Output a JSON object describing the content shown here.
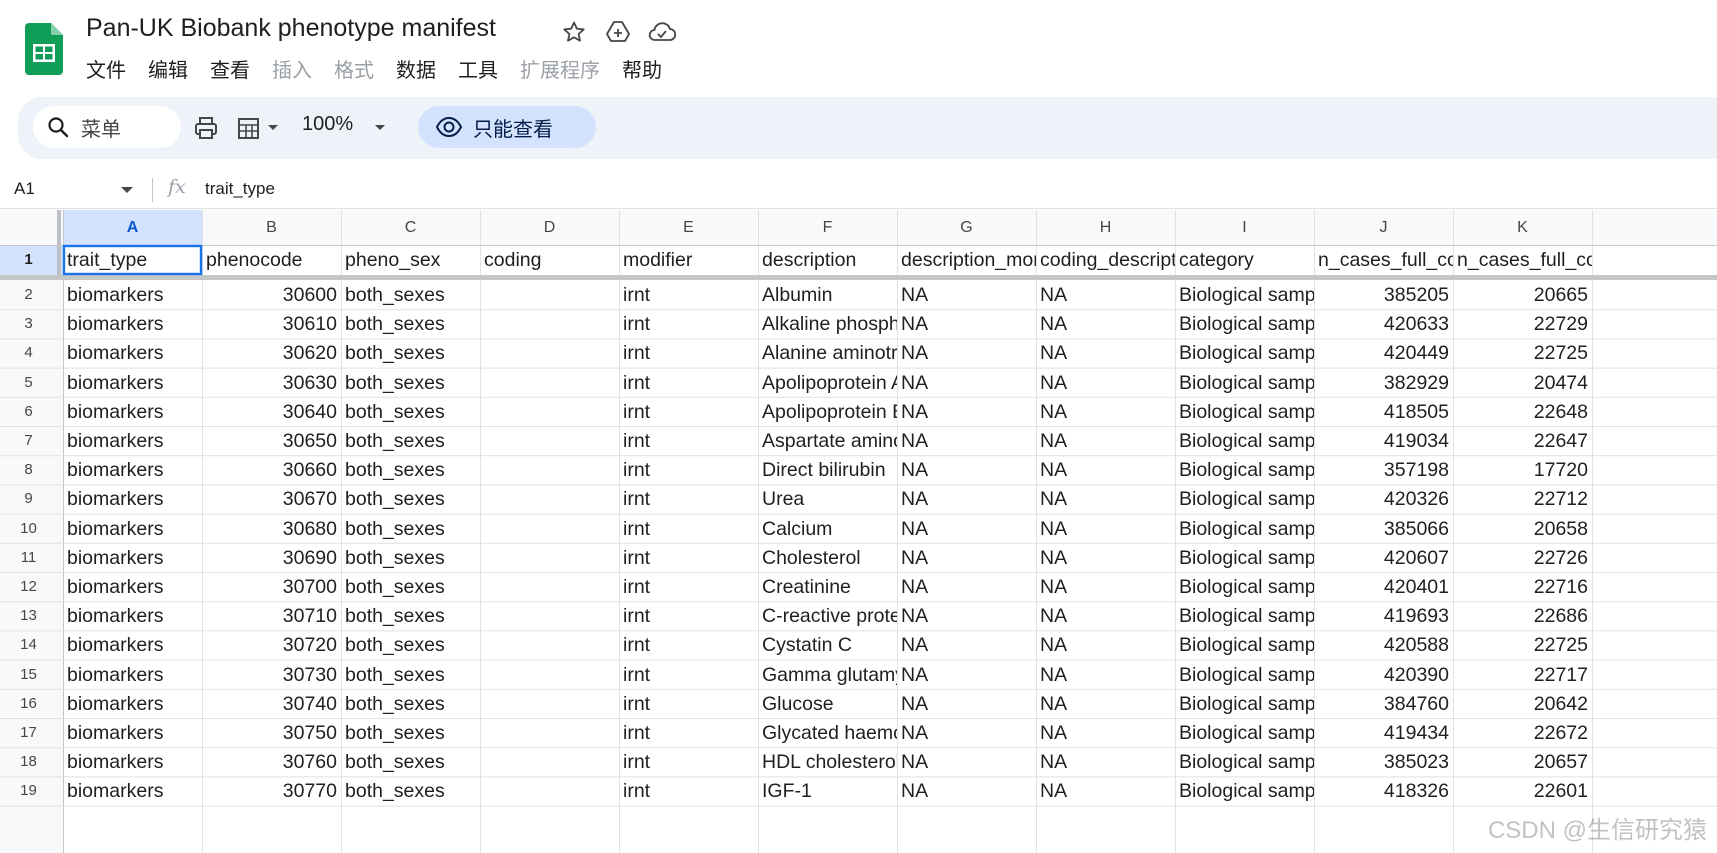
{
  "app": {
    "title": "Pan-UK Biobank phenotype manifest",
    "brand_color": "#0f9d58"
  },
  "title_icons": [
    "star-icon",
    "move-to-drive-icon",
    "cloud-status-icon"
  ],
  "menu": [
    {
      "label": "文件",
      "enabled": true
    },
    {
      "label": "编辑",
      "enabled": true
    },
    {
      "label": "查看",
      "enabled": true
    },
    {
      "label": "插入",
      "enabled": false
    },
    {
      "label": "格式",
      "enabled": false
    },
    {
      "label": "数据",
      "enabled": true
    },
    {
      "label": "工具",
      "enabled": true
    },
    {
      "label": "扩展程序",
      "enabled": false
    },
    {
      "label": "帮助",
      "enabled": true
    }
  ],
  "toolbar": {
    "search_label": "菜单",
    "zoom": "100%",
    "view_only_label": "只能查看"
  },
  "formula_bar": {
    "cell_ref": "A1",
    "fx": "fx",
    "content": "trait_type"
  },
  "sheet": {
    "columns": [
      "A",
      "B",
      "C",
      "D",
      "E",
      "F",
      "G",
      "H",
      "I",
      "J",
      "K"
    ],
    "active_column": "A",
    "header_row": [
      "trait_type",
      "phenocode",
      "pheno_sex",
      "coding",
      "modifier",
      "description",
      "description_more",
      "coding_description",
      "category",
      "n_cases_full_cohort_both_sexes",
      "n_cases_full_cohort_females"
    ],
    "rows": [
      {
        "n": "2",
        "cells": [
          "biomarkers",
          "30600",
          "both_sexes",
          "",
          "irnt",
          "Albumin",
          "NA",
          "NA",
          "Biological samples",
          "385205",
          "20665"
        ]
      },
      {
        "n": "3",
        "cells": [
          "biomarkers",
          "30610",
          "both_sexes",
          "",
          "irnt",
          "Alkaline phosphatase",
          "NA",
          "NA",
          "Biological samples",
          "420633",
          "22729"
        ]
      },
      {
        "n": "4",
        "cells": [
          "biomarkers",
          "30620",
          "both_sexes",
          "",
          "irnt",
          "Alanine aminotransferase",
          "NA",
          "NA",
          "Biological samples",
          "420449",
          "22725"
        ]
      },
      {
        "n": "5",
        "cells": [
          "biomarkers",
          "30630",
          "both_sexes",
          "",
          "irnt",
          "Apolipoprotein A",
          "NA",
          "NA",
          "Biological samples",
          "382929",
          "20474"
        ]
      },
      {
        "n": "6",
        "cells": [
          "biomarkers",
          "30640",
          "both_sexes",
          "",
          "irnt",
          "Apolipoprotein B",
          "NA",
          "NA",
          "Biological samples",
          "418505",
          "22648"
        ]
      },
      {
        "n": "7",
        "cells": [
          "biomarkers",
          "30650",
          "both_sexes",
          "",
          "irnt",
          "Aspartate aminotransferase",
          "NA",
          "NA",
          "Biological samples",
          "419034",
          "22647"
        ]
      },
      {
        "n": "8",
        "cells": [
          "biomarkers",
          "30660",
          "both_sexes",
          "",
          "irnt",
          "Direct bilirubin",
          "NA",
          "NA",
          "Biological samples",
          "357198",
          "17720"
        ]
      },
      {
        "n": "9",
        "cells": [
          "biomarkers",
          "30670",
          "both_sexes",
          "",
          "irnt",
          "Urea",
          "NA",
          "NA",
          "Biological samples",
          "420326",
          "22712"
        ]
      },
      {
        "n": "10",
        "cells": [
          "biomarkers",
          "30680",
          "both_sexes",
          "",
          "irnt",
          "Calcium",
          "NA",
          "NA",
          "Biological samples",
          "385066",
          "20658"
        ]
      },
      {
        "n": "11",
        "cells": [
          "biomarkers",
          "30690",
          "both_sexes",
          "",
          "irnt",
          "Cholesterol",
          "NA",
          "NA",
          "Biological samples",
          "420607",
          "22726"
        ]
      },
      {
        "n": "12",
        "cells": [
          "biomarkers",
          "30700",
          "both_sexes",
          "",
          "irnt",
          "Creatinine",
          "NA",
          "NA",
          "Biological samples",
          "420401",
          "22716"
        ]
      },
      {
        "n": "13",
        "cells": [
          "biomarkers",
          "30710",
          "both_sexes",
          "",
          "irnt",
          "C-reactive protein",
          "NA",
          "NA",
          "Biological samples",
          "419693",
          "22686"
        ]
      },
      {
        "n": "14",
        "cells": [
          "biomarkers",
          "30720",
          "both_sexes",
          "",
          "irnt",
          "Cystatin C",
          "NA",
          "NA",
          "Biological samples",
          "420588",
          "22725"
        ]
      },
      {
        "n": "15",
        "cells": [
          "biomarkers",
          "30730",
          "both_sexes",
          "",
          "irnt",
          "Gamma glutamyltransferase",
          "NA",
          "NA",
          "Biological samples",
          "420390",
          "22717"
        ]
      },
      {
        "n": "16",
        "cells": [
          "biomarkers",
          "30740",
          "both_sexes",
          "",
          "irnt",
          "Glucose",
          "NA",
          "NA",
          "Biological samples",
          "384760",
          "20642"
        ]
      },
      {
        "n": "17",
        "cells": [
          "biomarkers",
          "30750",
          "both_sexes",
          "",
          "irnt",
          "Glycated haemoglobin",
          "NA",
          "NA",
          "Biological samples",
          "419434",
          "22672"
        ]
      },
      {
        "n": "18",
        "cells": [
          "biomarkers",
          "30760",
          "both_sexes",
          "",
          "irnt",
          "HDL cholesterol",
          "NA",
          "NA",
          "Biological samples",
          "385023",
          "20657"
        ]
      },
      {
        "n": "19",
        "cells": [
          "biomarkers",
          "30770",
          "both_sexes",
          "",
          "irnt",
          "IGF-1",
          "NA",
          "NA",
          "Biological samples",
          "418326",
          "22601"
        ]
      }
    ]
  },
  "watermark": "CSDN @生信研究猿"
}
